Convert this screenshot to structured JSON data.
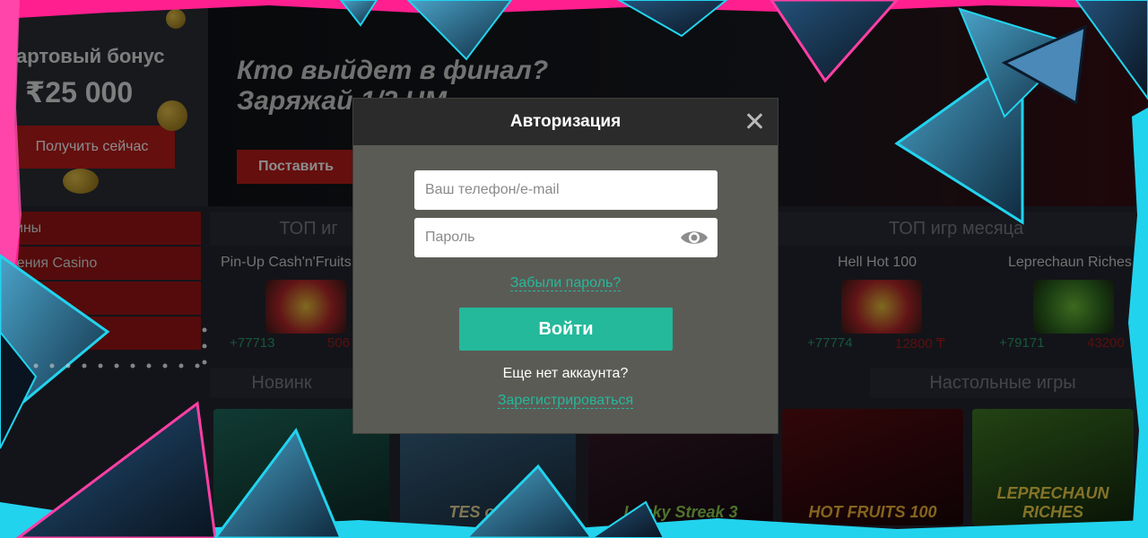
{
  "background": {
    "bonus": {
      "text": "артовый бонус",
      "amount": "₹25 000",
      "button": "Получить сейчас"
    },
    "banner": {
      "title": "Кто выйдет в финал?\nЗаряжай        1/2 ЧМ",
      "button": "Поставить"
    },
    "side_menu": [
      "рины",
      "жения Casino",
      "",
      ""
    ],
    "top_left_header": "ТОП иг",
    "top_right_header": "ТОП игр месяца",
    "games": [
      {
        "name": "Pin-Up Cash'n'Fruits",
        "win": "+77713",
        "amount": "506"
      },
      {
        "name": "Hell Hot 100",
        "win": "+77774",
        "amount": "12800 ₸"
      },
      {
        "name": "Leprechaun Riches",
        "win": "+79171",
        "amount": "43200"
      }
    ],
    "new_header": "Новинк",
    "table_header": "Настольные игры",
    "tiles": [
      {
        "label": ""
      },
      {
        "label": "TES of OL"
      },
      {
        "label": "Lucky Streak 3"
      },
      {
        "label": "HOT FRUITS 100"
      },
      {
        "label": "LEPRECHAUN RICHES"
      }
    ]
  },
  "modal": {
    "title": "Авторизация",
    "phone_placeholder": "Ваш телефон/e-mail",
    "password_placeholder": "Пароль",
    "forgot_link": "Забыли пароль?",
    "login_button": "Войти",
    "no_account_text": "Еще нет аккаунта?",
    "register_link": "Зарегистрироваться"
  },
  "colors": {
    "accent": "#23b99a",
    "modal_bg": "#5b5b56",
    "modal_header": "#2b2b2b",
    "brand_red": "#b81d1a",
    "frame_pink": "#ff1f8e",
    "frame_cyan": "#22d3ee"
  },
  "icons": {
    "close": "close-icon",
    "eye": "eye-icon"
  }
}
